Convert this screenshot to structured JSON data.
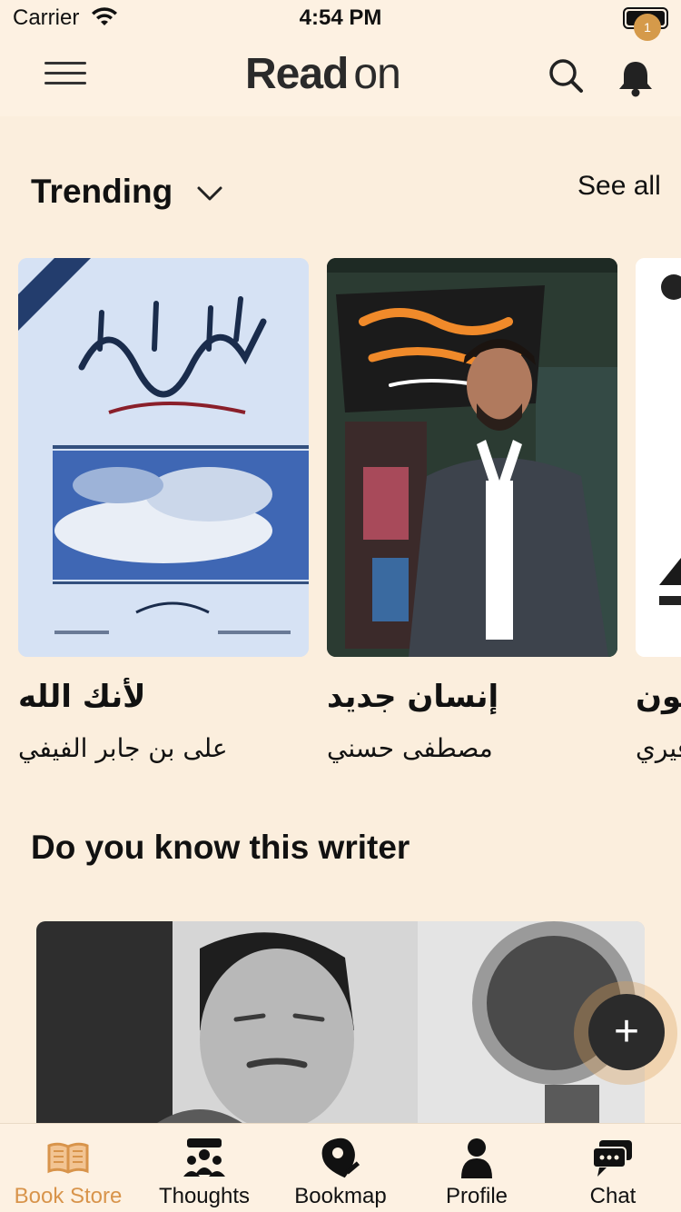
{
  "status_bar": {
    "carrier": "Carrier",
    "time": "4:54 PM"
  },
  "header": {
    "logo_bold": "Read",
    "logo_light": "on",
    "notification_count": "1"
  },
  "trending": {
    "title": "Trending",
    "see_all": "See all",
    "books": [
      {
        "title": "لأنك الله",
        "author": "على بن جابر الفيفي"
      },
      {
        "title": "إنسان جديد",
        "author": "مصطفى حسني"
      },
      {
        "title": "عون",
        "author": "قيري"
      }
    ]
  },
  "writer_section": {
    "title": "Do you know this writer"
  },
  "fab": {
    "label": "+"
  },
  "tabs": [
    {
      "label": "Book Store",
      "icon": "open-book-icon",
      "active": true
    },
    {
      "label": "Thoughts",
      "icon": "group-icon",
      "active": false
    },
    {
      "label": "Bookmap",
      "icon": "map-pin-icon",
      "active": false
    },
    {
      "label": "Profile",
      "icon": "person-icon",
      "active": false
    },
    {
      "label": "Chat",
      "icon": "chat-bubble-icon",
      "active": false
    }
  ],
  "colors": {
    "background": "#fbeedd",
    "accent": "#d8944b",
    "dark": "#2b2b2b"
  }
}
